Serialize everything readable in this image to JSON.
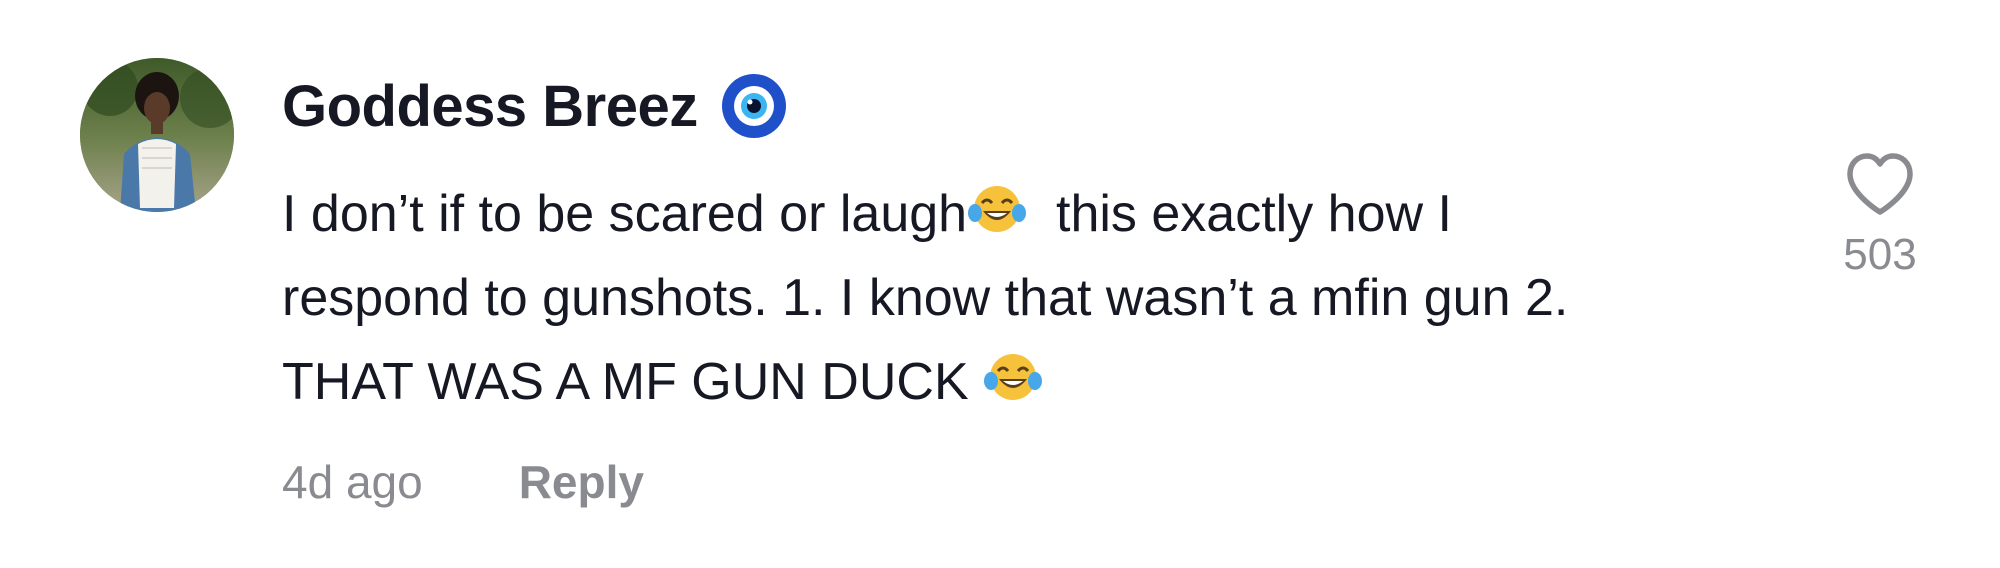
{
  "comment": {
    "author": "Goddess Breez",
    "author_badge_icon": "nazar-evil-eye-icon",
    "text_lines": [
      [
        "I don’t if to be scared or laugh",
        "this exactly how I"
      ],
      [
        "respond to gunshots. 1. I know that wasn’t a mfin gun 2."
      ],
      [
        "THAT WAS A MF GUN DUCK"
      ]
    ],
    "emoji_icon": "face-with-tears-of-joy-icon",
    "timestamp": "4d ago",
    "reply_label": "Reply",
    "like_icon": "heart-outline-icon",
    "like_count": "503"
  },
  "colors": {
    "text_primary": "#161823",
    "text_secondary": "#8a8b91"
  }
}
